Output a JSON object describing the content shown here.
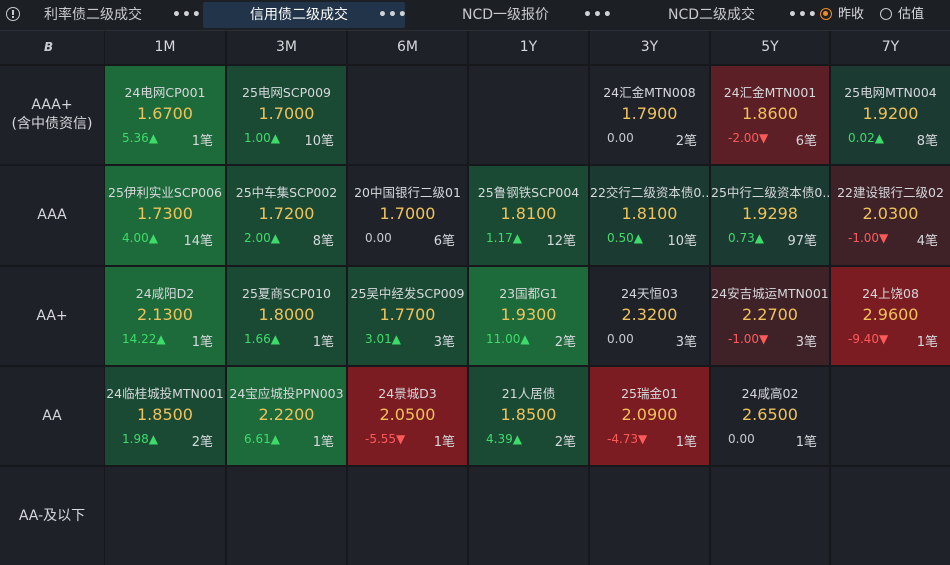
{
  "tabs": [
    {
      "label": "利率债二级成交",
      "active": false
    },
    {
      "label": "信用债二级成交",
      "active": true
    },
    {
      "label": "NCD一级报价",
      "active": false
    },
    {
      "label": "NCD二级成交",
      "active": false
    }
  ],
  "more_dots": "•••",
  "radio": {
    "options": [
      {
        "label": "昨收",
        "selected": true
      },
      {
        "label": "估值",
        "selected": false
      }
    ]
  },
  "logo_glyph": "B",
  "columns": [
    "1M",
    "3M",
    "6M",
    "1Y",
    "3Y",
    "5Y",
    "7Y"
  ],
  "rows": [
    {
      "label": "AAA+\n(含中债资信)",
      "cells": [
        {
          "name": "24电网CP001",
          "price": "1.6700",
          "change": "5.36▲",
          "count": "1笔",
          "dir": "up",
          "tone": "g1"
        },
        {
          "name": "25电网SCP009",
          "price": "1.7000",
          "change": "1.00▲",
          "count": "10笔",
          "dir": "up",
          "tone": "g2"
        },
        null,
        null,
        {
          "name": "24汇金MTN008",
          "price": "1.7900",
          "change": "0.00",
          "count": "2笔",
          "dir": "fl",
          "tone": "n"
        },
        {
          "name": "24汇金MTN001",
          "price": "1.8600",
          "change": "-2.00▼",
          "count": "6笔",
          "dir": "dn",
          "tone": "r2"
        },
        {
          "name": "25电网MTN004",
          "price": "1.9200",
          "change": "0.02▲",
          "count": "8笔",
          "dir": "up",
          "tone": "g3"
        }
      ]
    },
    {
      "label": "AAA",
      "cells": [
        {
          "name": "25伊利实业SCP006",
          "price": "1.7300",
          "change": "4.00▲",
          "count": "14笔",
          "dir": "up",
          "tone": "g1"
        },
        {
          "name": "25中车集SCP002",
          "price": "1.7200",
          "change": "2.00▲",
          "count": "8笔",
          "dir": "up",
          "tone": "g2"
        },
        {
          "name": "20中国银行二级01",
          "price": "1.7000",
          "change": "0.00",
          "count": "6笔",
          "dir": "fl",
          "tone": "n"
        },
        {
          "name": "25鲁钢铁SCP004",
          "price": "1.8100",
          "change": "1.17▲",
          "count": "12笔",
          "dir": "up",
          "tone": "g2"
        },
        {
          "name": "22交行二级资本债0...",
          "price": "1.8100",
          "change": "0.50▲",
          "count": "10笔",
          "dir": "up",
          "tone": "g3"
        },
        {
          "name": "25中行二级资本债0...",
          "price": "1.9298",
          "change": "0.73▲",
          "count": "97笔",
          "dir": "up",
          "tone": "g3"
        },
        {
          "name": "22建设银行二级02",
          "price": "2.0300",
          "change": "-1.00▼",
          "count": "4笔",
          "dir": "dn",
          "tone": "r3"
        }
      ]
    },
    {
      "label": "AA+",
      "cells": [
        {
          "name": "24咸阳D2",
          "price": "2.1300",
          "change": "14.22▲",
          "count": "1笔",
          "dir": "up",
          "tone": "g1"
        },
        {
          "name": "25夏商SCP010",
          "price": "1.8000",
          "change": "1.66▲",
          "count": "1笔",
          "dir": "up",
          "tone": "g2"
        },
        {
          "name": "25吴中经发SCP009",
          "price": "1.7700",
          "change": "3.01▲",
          "count": "3笔",
          "dir": "up",
          "tone": "g2"
        },
        {
          "name": "23国都G1",
          "price": "1.9300",
          "change": "11.00▲",
          "count": "2笔",
          "dir": "up",
          "tone": "g1"
        },
        {
          "name": "24天恒03",
          "price": "2.3200",
          "change": "0.00",
          "count": "3笔",
          "dir": "fl",
          "tone": "n"
        },
        {
          "name": "24安吉城运MTN001",
          "price": "2.2700",
          "change": "-1.00▼",
          "count": "3笔",
          "dir": "dn",
          "tone": "r3"
        },
        {
          "name": "24上饶08",
          "price": "2.9600",
          "change": "-9.40▼",
          "count": "1笔",
          "dir": "dn",
          "tone": "r1"
        }
      ]
    },
    {
      "label": "AA",
      "cells": [
        {
          "name": "24临桂城投MTN001",
          "price": "1.8500",
          "change": "1.98▲",
          "count": "2笔",
          "dir": "up",
          "tone": "g2"
        },
        {
          "name": "24宝应城投PPN003",
          "price": "2.2200",
          "change": "6.61▲",
          "count": "1笔",
          "dir": "up",
          "tone": "g1"
        },
        {
          "name": "24景城D3",
          "price": "2.0500",
          "change": "-5.55▼",
          "count": "1笔",
          "dir": "dn",
          "tone": "r1"
        },
        {
          "name": "21人居债",
          "price": "1.8500",
          "change": "4.39▲",
          "count": "2笔",
          "dir": "up",
          "tone": "g2"
        },
        {
          "name": "25瑞金01",
          "price": "2.0900",
          "change": "-4.73▼",
          "count": "1笔",
          "dir": "dn",
          "tone": "r1"
        },
        {
          "name": "24咸高02",
          "price": "2.6500",
          "change": "0.00",
          "count": "1笔",
          "dir": "fl",
          "tone": "n"
        },
        null
      ]
    },
    {
      "label": "AA-及以下",
      "cells": [
        null,
        null,
        null,
        null,
        null,
        null,
        null
      ]
    }
  ]
}
